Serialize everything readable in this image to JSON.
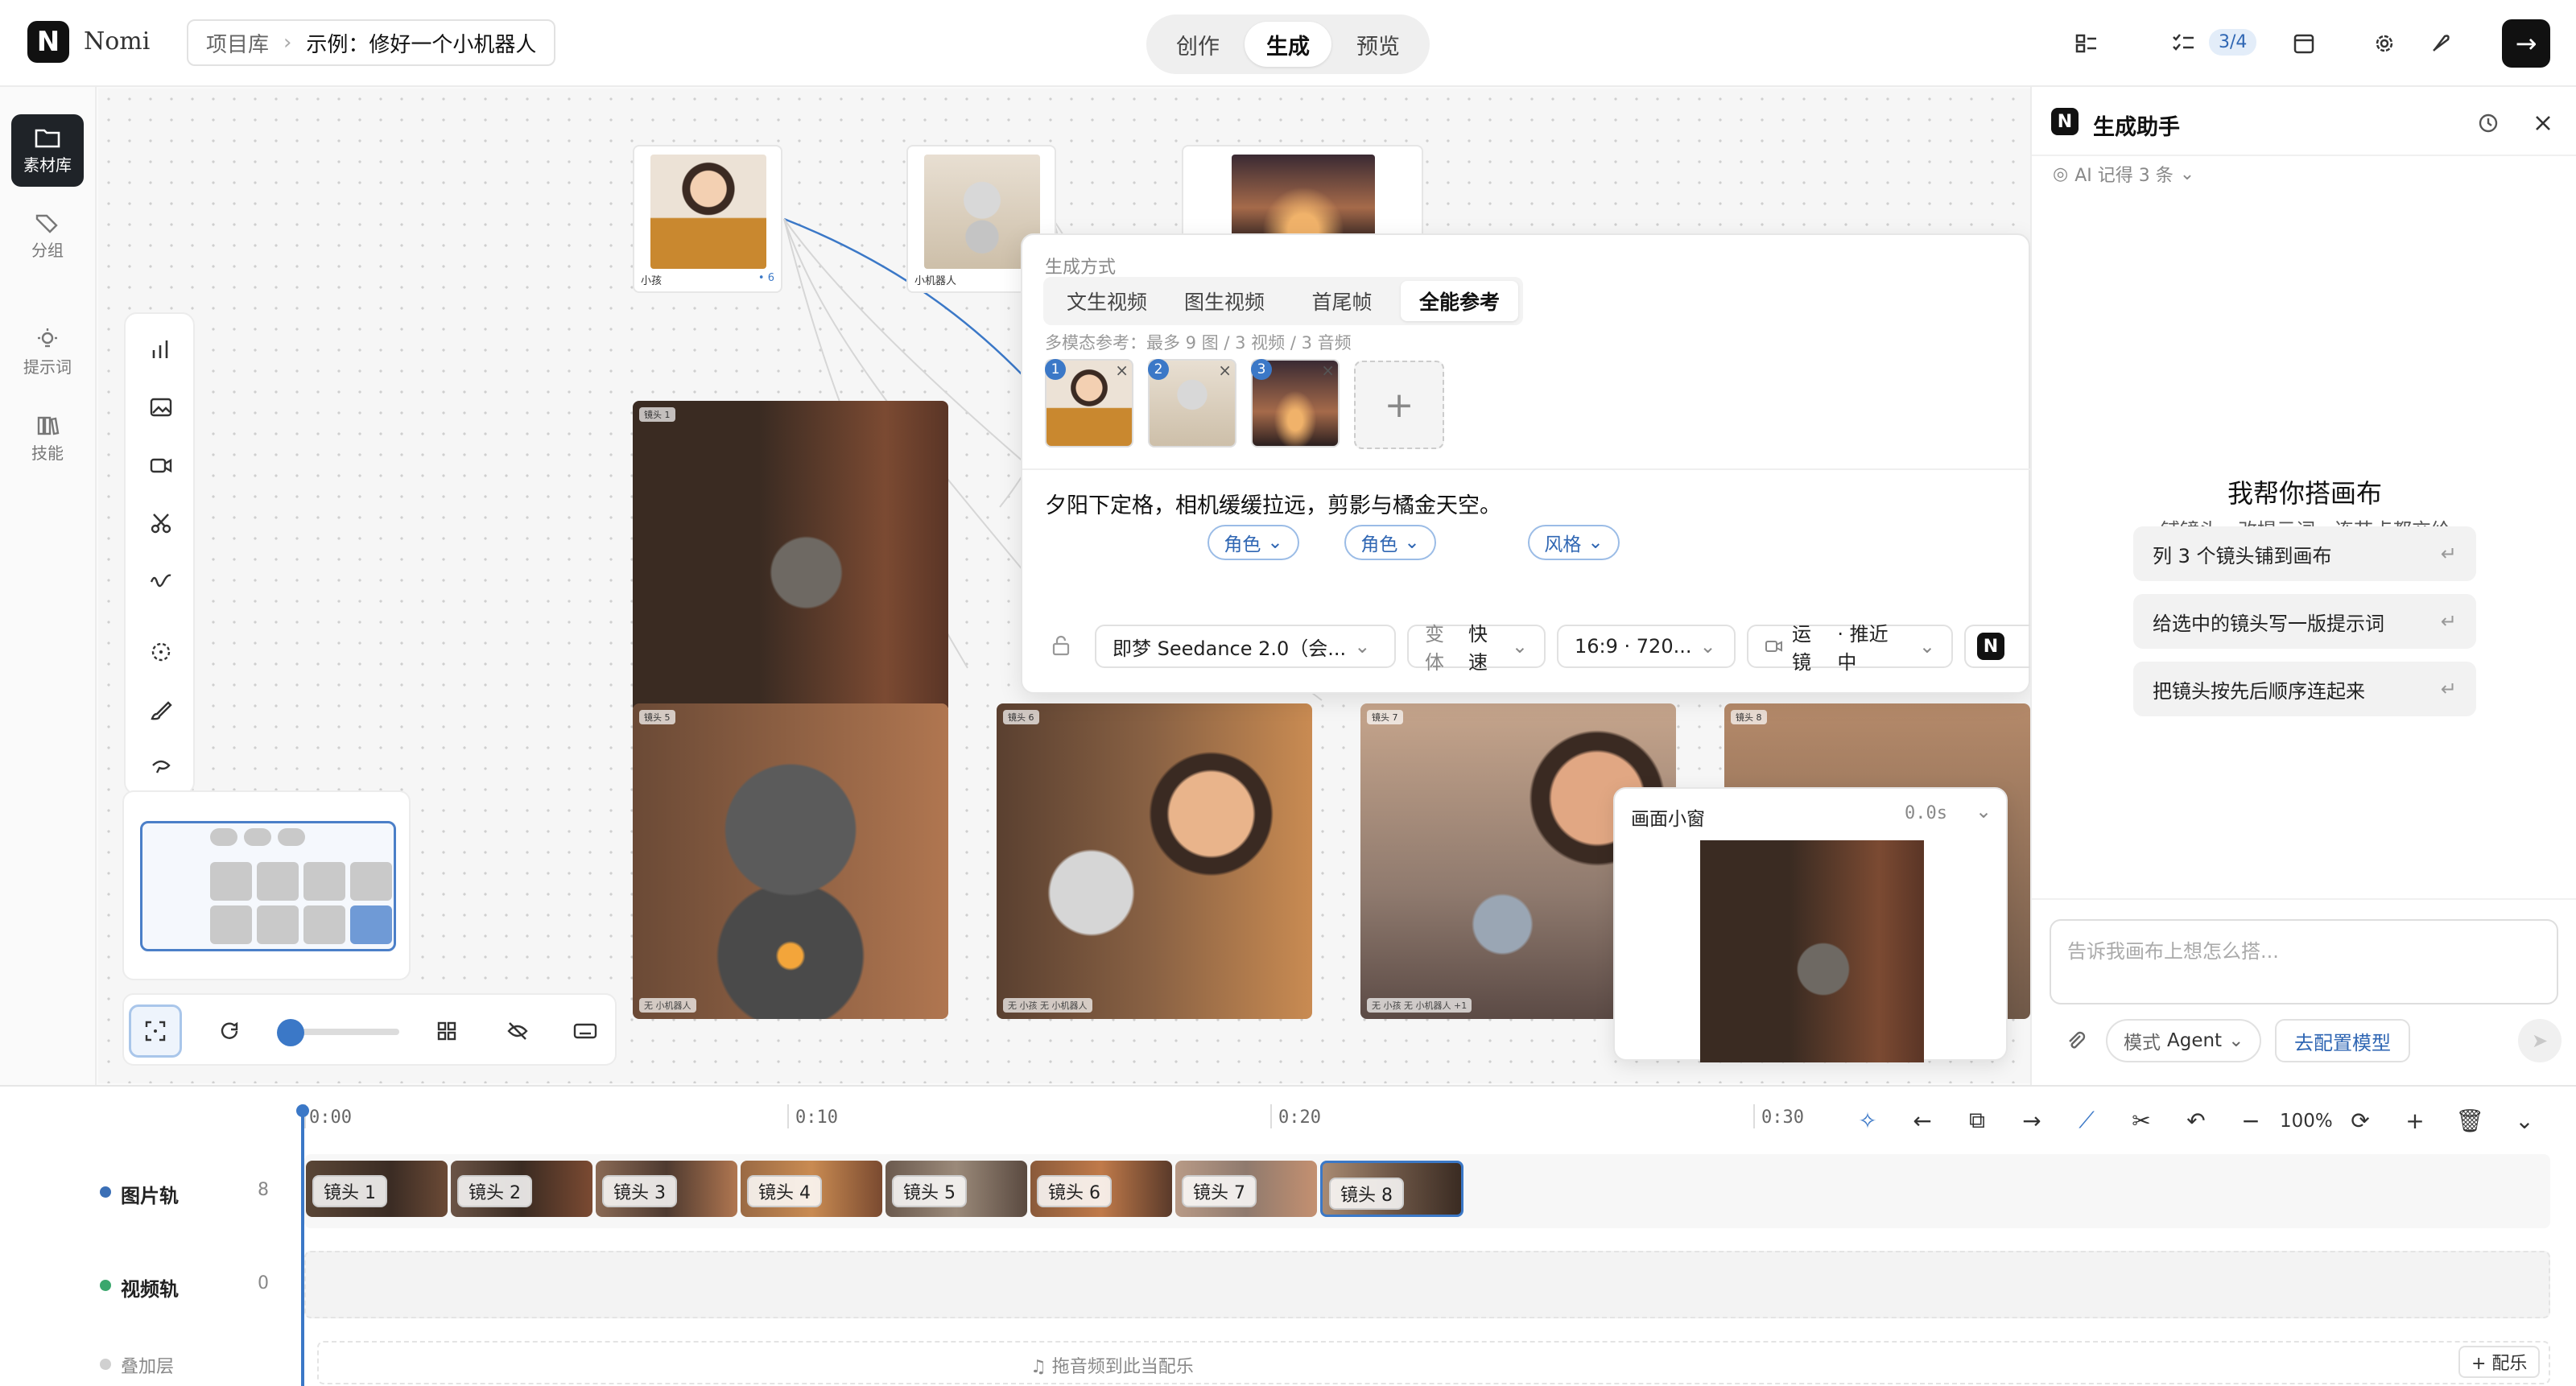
{
  "header": {
    "app_name": "Nomi",
    "logo_letter": "N",
    "breadcrumb": {
      "root": "项目库",
      "separator": "›",
      "current": "示例：修好一个小机器人"
    },
    "modes": [
      {
        "label": "创作",
        "active": false
      },
      {
        "label": "生成",
        "active": true
      },
      {
        "label": "预览",
        "active": false
      }
    ],
    "task_progress": "3/4"
  },
  "left_rail": {
    "items": [
      {
        "label": "素材库",
        "icon": "folder-icon",
        "active": true
      },
      {
        "label": "分组",
        "icon": "tags-icon",
        "active": false
      },
      {
        "label": "提示词",
        "icon": "lightbulb-icon",
        "active": false
      },
      {
        "label": "技能",
        "icon": "books-icon",
        "active": false
      }
    ]
  },
  "canvas": {
    "nodes": [
      {
        "caption": "小孩",
        "meta": "• 6"
      },
      {
        "caption": "小机器人",
        "meta": ""
      },
      {
        "caption": "",
        "meta": ""
      }
    ],
    "frames": [
      {
        "tag": "镜头 1",
        "chips": ""
      },
      {
        "tag": "镜头 5",
        "chips": "无 小机器人"
      },
      {
        "tag": "镜头 6",
        "chips": "无 小孩  无 小机器人"
      },
      {
        "tag": "镜头 7",
        "chips": "无 小孩  无 小机器人  +1"
      },
      {
        "tag": "镜头 8",
        "chips": ""
      }
    ]
  },
  "generate_panel": {
    "section_label": "生成方式",
    "tabs": [
      {
        "label": "文生视频",
        "active": false
      },
      {
        "label": "图生视频",
        "active": false
      },
      {
        "label": "首尾帧",
        "active": false
      },
      {
        "label": "全能参考",
        "active": true
      }
    ],
    "multi_ref_hint": "多模态参考：最多 9 图 / 3 视频 / 3 音频",
    "refs": [
      "1",
      "2",
      "3"
    ],
    "add_ref": "+",
    "prompt": "夕阳下定格，相机缓缓拉远，剪影与橘金天空。",
    "tag_chips": [
      "角色",
      "角色",
      "风格"
    ],
    "model": "即梦 Seedance 2.0（会...",
    "variant_label": "变体",
    "variant_value": "快速",
    "ratio": "16:9 · 720...",
    "camera_label": "运镜",
    "camera_value": "· 推近 中"
  },
  "float_window": {
    "title": "画面小窗",
    "time": "0.0s"
  },
  "assistant": {
    "title": "生成助手",
    "memory": "AI 记得 3 条",
    "heading": "我帮你搭画布",
    "description": "铺镜头、改提示词、连节点都交给我；出图按节点上的「生成」键。",
    "suggestions": [
      "列 3 个镜头铺到画布",
      "给选中的镜头写一版提示词",
      "把镜头按先后顺序连起来"
    ],
    "input_placeholder": "告诉我画布上想怎么搭...",
    "mode_label": "模式",
    "mode_value": "Agent",
    "config_model": "去配置模型"
  },
  "timeline": {
    "ticks": [
      "0:00",
      "0:10",
      "0:20",
      "0:30"
    ],
    "zoom": "100%",
    "tracks": [
      {
        "name": "图片轨",
        "count": "8",
        "color": "#3b6fb6"
      },
      {
        "name": "视频轨",
        "count": "0",
        "color": "#3aa76d"
      },
      {
        "name": "叠加层",
        "count": "",
        "color": "#d0d0d0"
      }
    ],
    "clips": [
      "镜头 1",
      "镜头 2",
      "镜头 3",
      "镜头 4",
      "镜头 5",
      "镜头 6",
      "镜头 7",
      "镜头 8"
    ],
    "drop_hint": "拖音频到此当配乐",
    "add_music": "+ 配乐"
  }
}
